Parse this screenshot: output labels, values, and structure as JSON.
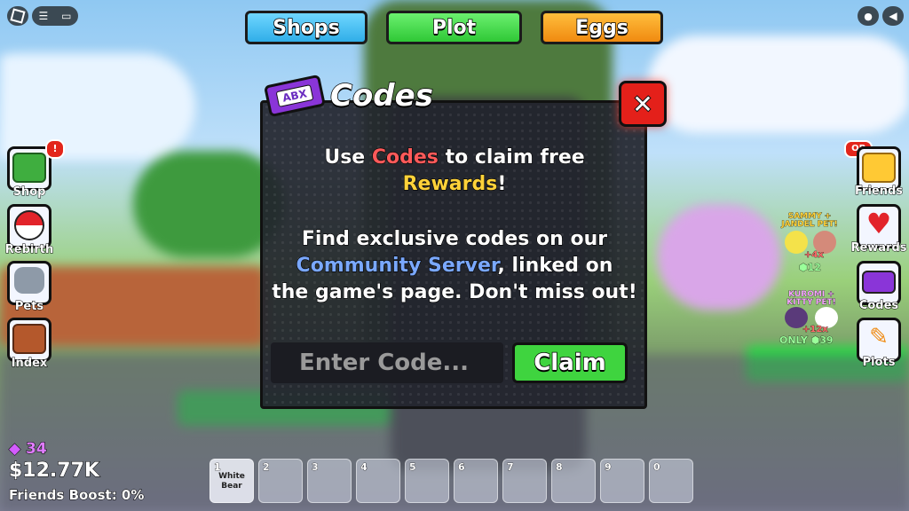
{
  "topbar": {
    "tabs": [
      {
        "label": "Shops",
        "color": "#4fc3f0"
      },
      {
        "label": "Plot",
        "color": "#45d84a"
      },
      {
        "label": "Eggs",
        "color": "#f7a01a"
      }
    ]
  },
  "left_menu": [
    {
      "label": "Shop",
      "icon": "cash-stack-icon"
    },
    {
      "label": "Rebirth",
      "icon": "pokeball-icon"
    },
    {
      "label": "Pets",
      "icon": "raccoon-icon"
    },
    {
      "label": "Index",
      "icon": "book-icon"
    }
  ],
  "left_badge": "!",
  "right_menu": [
    {
      "label": "Friends",
      "icon": "friends-icon"
    },
    {
      "label": "Rewards",
      "icon": "heart-icon"
    },
    {
      "label": "Codes",
      "icon": "abx-ticket-icon"
    },
    {
      "label": "Plots",
      "icon": "pencil-icon"
    }
  ],
  "right_badge": "OP",
  "promos": [
    {
      "title": "SAMMY + JANDEL PET!",
      "multiplier": "+4x",
      "price": "12"
    },
    {
      "title": "KUROMI + KITTY PET!",
      "multiplier": "+12x",
      "price_prefix": "ONLY",
      "price": "39"
    }
  ],
  "codes_modal": {
    "badge": "ABX",
    "title": "Codes",
    "line1_a": "Use ",
    "line1_b": "Codes",
    "line1_c": " to claim free",
    "line2_a": "Rewards",
    "line2_b": "!",
    "line3": "Find exclusive codes on our",
    "line4_a": "Community Server",
    "line4_b": ", linked on",
    "line5": "the game's page. Don't miss out!",
    "input_placeholder": "Enter Code...",
    "claim_label": "Claim",
    "close_label": "✕",
    "colors": {
      "codes": "#ff5a5a",
      "rewards": "#ffd23a",
      "community": "#7aa8ff"
    }
  },
  "stats": {
    "gems": "34",
    "cash": "$12.77K",
    "friends_boost": "Friends Boost: 0%"
  },
  "hotbar": [
    {
      "num": "1",
      "name": "White Bear"
    },
    {
      "num": "2",
      "name": ""
    },
    {
      "num": "3",
      "name": ""
    },
    {
      "num": "4",
      "name": ""
    },
    {
      "num": "5",
      "name": ""
    },
    {
      "num": "6",
      "name": ""
    },
    {
      "num": "7",
      "name": ""
    },
    {
      "num": "8",
      "name": ""
    },
    {
      "num": "9",
      "name": ""
    },
    {
      "num": "0",
      "name": ""
    }
  ]
}
